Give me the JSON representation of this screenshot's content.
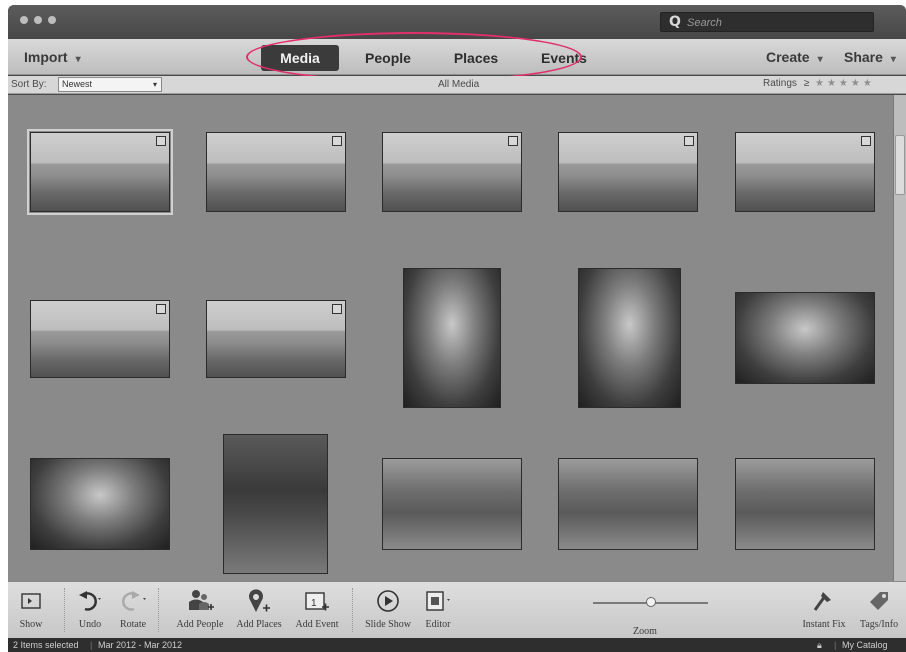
{
  "window": {
    "search_placeholder": "Search"
  },
  "menubar": {
    "import_label": "Import",
    "create_label": "Create",
    "share_label": "Share",
    "tabs": [
      {
        "label": "Media",
        "active": true
      },
      {
        "label": "People",
        "active": false
      },
      {
        "label": "Places",
        "active": false
      },
      {
        "label": "Events",
        "active": false
      }
    ]
  },
  "sortbar": {
    "sort_label": "Sort By:",
    "sort_value": "Newest",
    "view_title": "All Media",
    "ratings_label": "Ratings",
    "ratings_operator": "≥",
    "rating_stars": 5
  },
  "media": [
    {
      "kind": "landscape",
      "scene": "beach"
    },
    {
      "kind": "landscape",
      "scene": "beach"
    },
    {
      "kind": "landscape",
      "scene": "beach"
    },
    {
      "kind": "landscape",
      "scene": "beach"
    },
    {
      "kind": "landscape",
      "scene": "beach"
    },
    {
      "kind": "landscape",
      "scene": "beach"
    },
    {
      "kind": "landscape",
      "scene": "beach"
    },
    {
      "kind": "portrait",
      "scene": "portrait"
    },
    {
      "kind": "portrait",
      "scene": "portrait"
    },
    {
      "kind": "landscape",
      "scene": "portrait"
    },
    {
      "kind": "landscape",
      "scene": "portrait"
    },
    {
      "kind": "portrait",
      "scene": "forest"
    },
    {
      "kind": "landscape",
      "scene": "bike"
    },
    {
      "kind": "landscape",
      "scene": "bike"
    },
    {
      "kind": "landscape",
      "scene": "bike"
    }
  ],
  "toolbar": {
    "show": "Show",
    "undo": "Undo",
    "rotate": "Rotate",
    "add_people": "Add People",
    "add_places": "Add Places",
    "add_event": "Add Event",
    "slide_show": "Slide Show",
    "editor": "Editor",
    "zoom": "Zoom",
    "zoom_level": 0.55,
    "instant_fix": "Instant Fix",
    "tags_info": "Tags/Info"
  },
  "status": {
    "selected": "2 Items selected",
    "date_range": "Mar 2012 - Mar 2012",
    "catalog": "My Catalog"
  }
}
